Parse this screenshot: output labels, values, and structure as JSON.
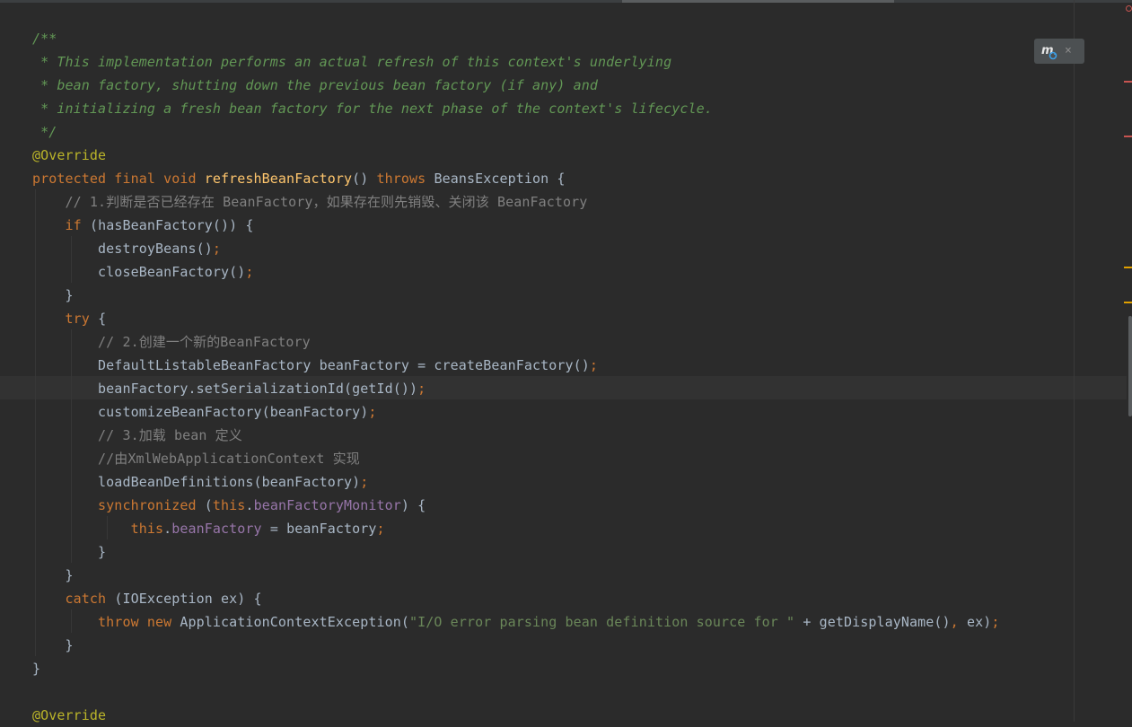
{
  "editor": {
    "lines": [
      [
        {
          "t": "/**",
          "c": "doc"
        }
      ],
      [
        {
          "t": " * This implementation performs an actual refresh of this context's underlying",
          "c": "doc"
        }
      ],
      [
        {
          "t": " * bean factory, shutting down the previous bean factory (if any) and",
          "c": "doc"
        }
      ],
      [
        {
          "t": " * initializing a fresh bean factory for the next phase of the context's lifecycle.",
          "c": "doc"
        }
      ],
      [
        {
          "t": " */",
          "c": "doc"
        }
      ],
      [
        {
          "t": "@Override",
          "c": "ann"
        }
      ],
      [
        {
          "t": "protected final void ",
          "c": "kw"
        },
        {
          "t": "refreshBeanFactory",
          "c": "fn"
        },
        {
          "t": "() ",
          "c": ""
        },
        {
          "t": "throws ",
          "c": "kw"
        },
        {
          "t": "BeansException {",
          "c": ""
        }
      ],
      [
        {
          "t": "    // 1.判断是否已经存在 BeanFactory，如果存在则先销毁、关闭该 BeanFactory",
          "c": "cm"
        }
      ],
      [
        {
          "t": "    ",
          "c": ""
        },
        {
          "t": "if ",
          "c": "kw"
        },
        {
          "t": "(hasBeanFactory()) {",
          "c": ""
        }
      ],
      [
        {
          "t": "        destroyBeans()",
          "c": ""
        },
        {
          "t": ";",
          "c": "kw"
        }
      ],
      [
        {
          "t": "        closeBeanFactory()",
          "c": ""
        },
        {
          "t": ";",
          "c": "kw"
        }
      ],
      [
        {
          "t": "    }",
          "c": ""
        }
      ],
      [
        {
          "t": "    ",
          "c": ""
        },
        {
          "t": "try ",
          "c": "kw"
        },
        {
          "t": "{",
          "c": ""
        }
      ],
      [
        {
          "t": "        // 2.创建一个新的BeanFactory",
          "c": "cm"
        }
      ],
      [
        {
          "t": "        DefaultListableBeanFactory beanFactory = createBeanFactory()",
          "c": ""
        },
        {
          "t": ";",
          "c": "kw"
        }
      ],
      [
        {
          "t": "        beanFactory.setSerializationId(getId())",
          "c": ""
        },
        {
          "t": ";",
          "c": "kw"
        }
      ],
      [
        {
          "t": "        customizeBeanFactory(beanFactory)",
          "c": ""
        },
        {
          "t": ";",
          "c": "kw"
        }
      ],
      [
        {
          "t": "        // 3.加载 bean 定义",
          "c": "cm"
        }
      ],
      [
        {
          "t": "        //由XmlWebApplicationContext 实现",
          "c": "cm"
        }
      ],
      [
        {
          "t": "        loadBeanDefinitions(beanFactory)",
          "c": ""
        },
        {
          "t": ";",
          "c": "kw"
        }
      ],
      [
        {
          "t": "        ",
          "c": ""
        },
        {
          "t": "synchronized ",
          "c": "kw"
        },
        {
          "t": "(",
          "c": ""
        },
        {
          "t": "this",
          "c": "kw"
        },
        {
          "t": ".",
          "c": ""
        },
        {
          "t": "beanFactoryMonitor",
          "c": "fld"
        },
        {
          "t": ") {",
          "c": ""
        }
      ],
      [
        {
          "t": "            ",
          "c": ""
        },
        {
          "t": "this",
          "c": "kw"
        },
        {
          "t": ".",
          "c": ""
        },
        {
          "t": "beanFactory",
          "c": "fld"
        },
        {
          "t": " = beanFactory",
          "c": ""
        },
        {
          "t": ";",
          "c": "kw"
        }
      ],
      [
        {
          "t": "        }",
          "c": ""
        }
      ],
      [
        {
          "t": "    }",
          "c": ""
        }
      ],
      [
        {
          "t": "    ",
          "c": ""
        },
        {
          "t": "catch ",
          "c": "kw"
        },
        {
          "t": "(IOException ex) {",
          "c": ""
        }
      ],
      [
        {
          "t": "        ",
          "c": ""
        },
        {
          "t": "throw new ",
          "c": "kw"
        },
        {
          "t": "ApplicationContextException(",
          "c": ""
        },
        {
          "t": "\"I/O error parsing bean definition source for \" ",
          "c": "str"
        },
        {
          "t": "+ getDisplayName()",
          "c": ""
        },
        {
          "t": ", ",
          "c": "kw"
        },
        {
          "t": "ex)",
          "c": ""
        },
        {
          "t": ";",
          "c": "kw"
        }
      ],
      [
        {
          "t": "    }",
          "c": ""
        }
      ],
      [
        {
          "t": "}",
          "c": ""
        }
      ],
      [
        {
          "t": "",
          "c": ""
        }
      ],
      [
        {
          "t": "@Override",
          "c": "ann"
        }
      ]
    ]
  },
  "popup": {
    "logo_icon": "maven-reload-icon",
    "close_icon": "close-icon",
    "close_glyph": "×"
  },
  "colors": {
    "background": "#2b2b2b",
    "keyword": "#cc7832",
    "method": "#ffc66d",
    "annotation": "#bbb529",
    "javadoc": "#629755",
    "comment": "#808080",
    "field": "#9876aa",
    "string": "#6a8759",
    "text": "#a9b7c6",
    "error_stripe": "#c75450",
    "warning_stripe": "#e0a000"
  }
}
